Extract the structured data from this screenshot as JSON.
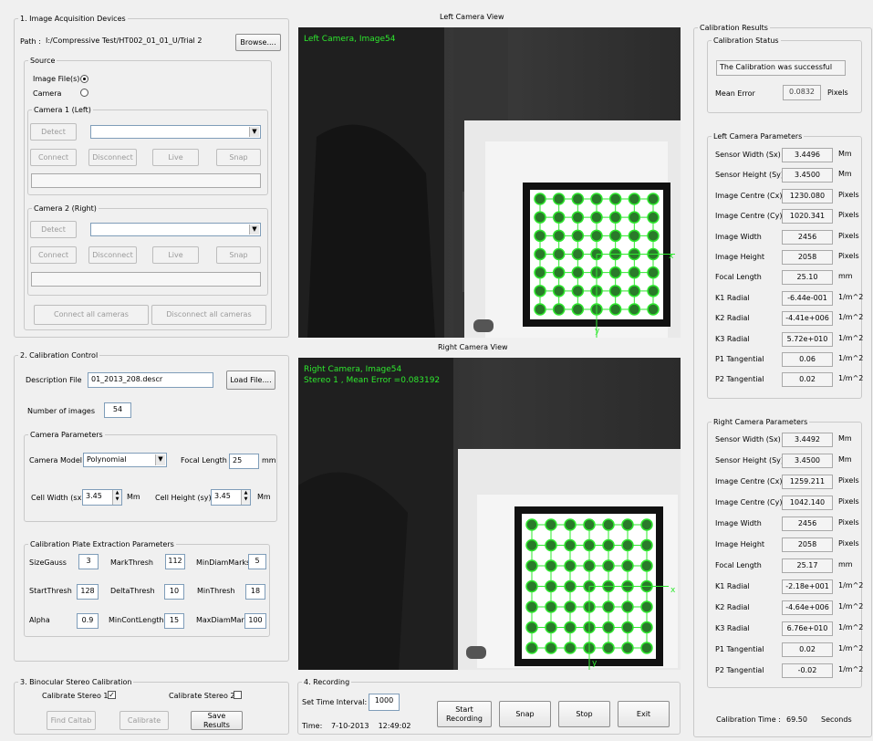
{
  "acquisition": {
    "title": "1. Image Acquisition Devices",
    "path_label": "Path :",
    "path_value": "I:/Compressive Test/HT002_01_01_U/Trial 2",
    "browse_label": "Browse....",
    "source_title": "Source",
    "image_files_label": "Image File(s)",
    "camera_label": "Camera",
    "cam1": {
      "title": "Camera 1 (Left)",
      "detect": "Detect",
      "connect": "Connect",
      "disconnect": "Disconnect",
      "live": "Live",
      "snap": "Snap"
    },
    "cam2": {
      "title": "Camera 2 (Right)",
      "detect": "Detect",
      "connect": "Connect",
      "disconnect": "Disconnect",
      "live": "Live",
      "snap": "Snap"
    },
    "connect_all": "Connect all cameras",
    "disconnect_all": "Disconnect all cameras"
  },
  "calib_control": {
    "title": "2. Calibration Control",
    "desc_label": "Description File",
    "desc_value": "01_2013_208.descr",
    "load_label": "Load File....",
    "num_images_label": "Number of images",
    "num_images_value": "54",
    "cam_params_title": "Camera Parameters",
    "model_label": "Camera Model",
    "model_value": "Polynomial",
    "focal_label": "Focal Length",
    "focal_value": "25",
    "focal_unit": "mm",
    "cell_w_label": "Cell Width (sx)",
    "cell_w_value": "3.45",
    "cell_w_unit": "Mm",
    "cell_h_label": "Cell Height (sy)",
    "cell_h_value": "3.45",
    "cell_h_unit": "Mm",
    "plate_title": "Calibration Plate Extraction Parameters",
    "plate": {
      "size_gauss_label": "SizeGauss",
      "size_gauss": "3",
      "mark_thresh_label": "MarkThresh",
      "mark_thresh": "112",
      "min_diam_label": "MinDiamMarks",
      "min_diam": "5",
      "start_thresh_label": "StartThresh",
      "start_thresh": "128",
      "delta_thresh_label": "DeltaThresh",
      "delta_thresh": "10",
      "min_thresh_label": "MinThresh",
      "min_thresh": "18",
      "alpha_label": "Alpha",
      "alpha": "0.9",
      "min_cont_label": "MinContLength",
      "min_cont": "15",
      "max_diam_label": "MaxDiamMarl",
      "max_diam": "100"
    }
  },
  "stereo": {
    "title": "3. Binocular Stereo Calibration",
    "stereo1_label": "Calibrate Stereo 1",
    "stereo1_checked": true,
    "stereo2_label": "Calibrate Stereo 2",
    "stereo2_checked": false,
    "find_caltab": "Find Caltab",
    "calibrate": "Calibrate",
    "save_results": "Save Results"
  },
  "views": {
    "left_title": "Left Camera View",
    "left_overlay": "Left Camera, Image54",
    "right_title": "Right Camera View",
    "right_overlay1": "Right Camera, Image54",
    "right_overlay2": "Stereo 1 , Mean Error =0.083192",
    "axis_x": "x",
    "axis_y": "y"
  },
  "recording": {
    "title": "4. Recording",
    "interval_label": "Set Time Interval:",
    "interval_value": "1000",
    "time_label": "Time:",
    "time_value": "7-10-2013    12:49:02",
    "start_label": "Start Recording",
    "snap_label": "Snap",
    "stop_label": "Stop",
    "exit_label": "Exit"
  },
  "results": {
    "title": "Calibration Results",
    "status_title": "Calibration Status",
    "status_text": "The Calibration was successful",
    "mean_error_label": "Mean Error",
    "mean_error_value": "0.0832",
    "mean_error_unit": "Pixels",
    "left_title": "Left Camera Parameters",
    "right_title": "Right Camera Parameters",
    "left_params": [
      {
        "label": "Sensor Width (Sx)",
        "value": "3.4496",
        "unit": "Mm"
      },
      {
        "label": "Sensor Height (Sy)",
        "value": "3.4500",
        "unit": "Mm"
      },
      {
        "label": "Image Centre (Cx)",
        "value": "1230.080",
        "unit": "Pixels"
      },
      {
        "label": "Image Centre (Cy)",
        "value": "1020.341",
        "unit": "Pixels"
      },
      {
        "label": "Image Width",
        "value": "2456",
        "unit": "Pixels"
      },
      {
        "label": "Image Height",
        "value": "2058",
        "unit": "Pixels"
      },
      {
        "label": "Focal Length",
        "value": "25.10",
        "unit": "mm"
      },
      {
        "label": "K1 Radial",
        "value": "-6.44e-001",
        "unit": "1/m^2"
      },
      {
        "label": "K2 Radial",
        "value": "-4.41e+006",
        "unit": "1/m^2"
      },
      {
        "label": "K3 Radial",
        "value": "5.72e+010",
        "unit": "1/m^2"
      },
      {
        "label": "P1 Tangential",
        "value": "0.06",
        "unit": "1/m^2"
      },
      {
        "label": "P2 Tangential",
        "value": "0.02",
        "unit": "1/m^2"
      }
    ],
    "right_params": [
      {
        "label": "Sensor Width (Sx)",
        "value": "3.4492",
        "unit": "Mm"
      },
      {
        "label": "Sensor Height (Sy)",
        "value": "3.4500",
        "unit": "Mm"
      },
      {
        "label": "Image Centre (Cx)",
        "value": "1259.211",
        "unit": "Pixels"
      },
      {
        "label": "Image Centre (Cy)",
        "value": "1042.140",
        "unit": "Pixels"
      },
      {
        "label": "Image Width",
        "value": "2456",
        "unit": "Pixels"
      },
      {
        "label": "Image Height",
        "value": "2058",
        "unit": "Pixels"
      },
      {
        "label": "Focal Length",
        "value": "25.17",
        "unit": "mm"
      },
      {
        "label": "K1 Radial",
        "value": "-2.18e+001",
        "unit": "1/m^2"
      },
      {
        "label": "K2 Radial",
        "value": "-4.64e+006",
        "unit": "1/m^2"
      },
      {
        "label": "K3 Radial",
        "value": "6.76e+010",
        "unit": "1/m^2"
      },
      {
        "label": "P1 Tangential",
        "value": "0.02",
        "unit": "1/m^2"
      },
      {
        "label": "P2 Tangential",
        "value": "-0.02",
        "unit": "1/m^2"
      }
    ],
    "calib_time_label": "Calibration Time :",
    "calib_time_value": "69.50",
    "calib_time_unit": "Seconds"
  },
  "colors": {
    "overlay_green": "#2ee82e",
    "calib_dot": "#2a7a2a"
  }
}
